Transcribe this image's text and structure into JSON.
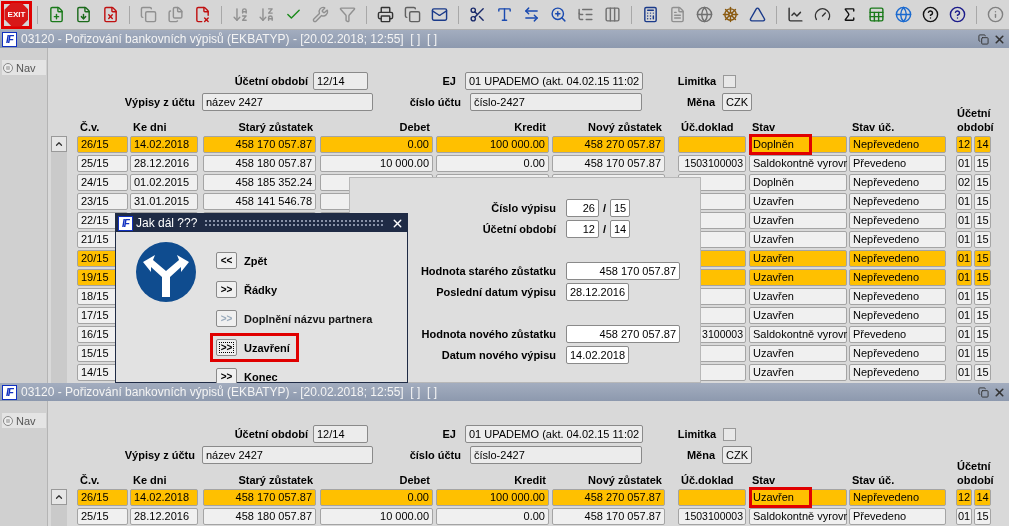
{
  "toolbar": {
    "exit_label": "EXIT",
    "exit_marked": true
  },
  "windows": [
    {
      "logo": "IF",
      "title": "03120 - Pořizování bankovních výpisů (EKBATYP) - [20.02.2018; 12:55]  [ ]  [ ]",
      "nav": "Nav",
      "form": {
        "period_label": "Účetní období",
        "period": "12/14",
        "ej_label": "EJ",
        "ej": "01 UPADEMO (akt. 04.02.15 11:02",
        "limit_label": "Limitka",
        "limit_checked": false,
        "account_label": "Výpisy z účtu",
        "account_name": "název 2427",
        "account_no_label": "číslo účtu",
        "account_no": "číslo-2427",
        "currency_label": "Měna",
        "currency": "CZK"
      },
      "columns": [
        "Č.v.",
        "Ke dni",
        "Starý zůstatek",
        "Debet",
        "Kredit",
        "Nový zůstatek",
        "Úč.doklad",
        "Stav",
        "Stav úč.",
        "Účetní období"
      ],
      "rows": [
        {
          "highlighted": true,
          "stav_marked": true,
          "cv": "26/15",
          "date": "14.02.2018",
          "old": "458 170 057.87",
          "debet": "0.00",
          "kredit": "100 000.00",
          "new": "458 270 057.87",
          "stav": "Doplněn",
          "stav_uc": "Nepřevedeno",
          "month": "12",
          "year": "14"
        },
        {
          "highlighted": false,
          "stav_marked": false,
          "cv": "25/15",
          "date": "28.12.2016",
          "old": "458 180 057.87",
          "debet": "10 000.00",
          "kredit": "0.00",
          "new": "458 170 057.87",
          "doklad": "1503100003",
          "stav": "Saldokontně vyrovr",
          "stav_uc": "Převedeno",
          "month": "01",
          "year": "15"
        },
        {
          "highlighted": false,
          "stav_marked": false,
          "cv": "24/15",
          "date": "01.02.2015",
          "old": "458 185 352.24",
          "stav": "Doplněn",
          "stav_uc": "Nepřevedeno",
          "month": "02",
          "year": "15"
        },
        {
          "highlighted": false,
          "stav_marked": false,
          "cv": "23/15",
          "date": "31.01.2015",
          "old": "458 141 546.78",
          "stav": "Uzavřen",
          "stav_uc": "Nepřevedeno",
          "month": "01",
          "year": "15"
        },
        {
          "highlighted": false,
          "stav_marked": false,
          "cv": "22/15",
          "stav": "Uzavřen",
          "stav_uc": "Nepřevedeno",
          "month": "01",
          "year": "15"
        },
        {
          "highlighted": false,
          "stav_marked": false,
          "cv": "21/15",
          "stav": "Uzavřen",
          "stav_uc": "Nepřevedeno",
          "month": "01",
          "year": "15"
        },
        {
          "highlighted": true,
          "stav_marked": false,
          "cv": "20/15",
          "stav": "Uzavřen",
          "stav_uc": "Nepřevedeno",
          "month": "01",
          "year": "15"
        },
        {
          "highlighted": true,
          "stav_marked": false,
          "cv": "19/15",
          "stav": "Uzavřen",
          "stav_uc": "Nepřevedeno",
          "month": "01",
          "year": "15"
        },
        {
          "highlighted": false,
          "stav_marked": false,
          "cv": "18/15",
          "stav": "Uzavřen",
          "stav_uc": "Nepřevedeno",
          "month": "01",
          "year": "15"
        },
        {
          "highlighted": false,
          "stav_marked": false,
          "cv": "17/15",
          "stav": "Uzavřen",
          "stav_uc": "Nepřevedeno",
          "month": "01",
          "year": "15"
        },
        {
          "highlighted": false,
          "stav_marked": false,
          "cv": "16/15",
          "doklad": "3100003",
          "stav": "Saldokontně vyrovr",
          "stav_uc": "Převedeno",
          "month": "01",
          "year": "15"
        },
        {
          "highlighted": false,
          "stav_marked": false,
          "cv": "15/15",
          "stav": "Uzavřen",
          "stav_uc": "Nepřevedeno",
          "month": "01",
          "year": "15"
        },
        {
          "highlighted": false,
          "stav_marked": false,
          "cv": "14/15",
          "stav": "Uzavřen",
          "stav_uc": "Nepřevedeno",
          "month": "01",
          "year": "15"
        }
      ],
      "statement_panel": {
        "groups": [
          [
            {
              "kind": "pair",
              "label": "Číslo výpisu",
              "value": "26",
              "separator": "/",
              "value2": "15"
            },
            {
              "kind": "pair",
              "label": "Účetní období",
              "value": "12",
              "separator": "/",
              "value2": "14"
            }
          ],
          [
            {
              "kind": "amount",
              "label": "Hodnota starého zůstatku",
              "value": "458 170 057.87"
            },
            {
              "kind": "date",
              "label": "Poslední datum výpisu",
              "value": "28.12.2016"
            }
          ],
          [
            {
              "kind": "amount",
              "label": "Hodnota nového zůstatku",
              "value": "458 270 057.87"
            },
            {
              "kind": "date",
              "label": "Datum nového výpisu",
              "value": "14.02.2018"
            }
          ]
        ]
      },
      "dialog": {
        "logo": "IF",
        "title": "Jak dál ???",
        "options": [
          {
            "arrows": "<<",
            "label": "Zpět",
            "disabled": false,
            "focused": false,
            "marked": false
          },
          {
            "arrows": ">>",
            "label": "Řádky",
            "disabled": false,
            "focused": false,
            "marked": false
          },
          {
            "arrows": ">>",
            "label": "Doplnění názvu partnera",
            "disabled": true,
            "focused": false,
            "marked": false
          },
          {
            "arrows": ">>",
            "label": "Uzavření",
            "disabled": false,
            "focused": true,
            "marked": true
          },
          {
            "arrows": ">>",
            "label": "Konec",
            "disabled": false,
            "focused": false,
            "marked": false
          }
        ]
      }
    },
    {
      "logo": "IF",
      "title": "03120 - Pořizování bankovních výpisů (EKBATYP) - [20.02.2018; 12:55]  [ ]  [ ]",
      "nav": "Nav",
      "form": {
        "period_label": "Účetní období",
        "period": "12/14",
        "ej_label": "EJ",
        "ej": "01 UPADEMO (akt. 04.02.15 11:02",
        "limit_label": "Limitka",
        "limit_checked": false,
        "account_label": "Výpisy z účtu",
        "account_name": "název 2427",
        "account_no_label": "číslo účtu",
        "account_no": "číslo-2427",
        "currency_label": "Měna",
        "currency": "CZK"
      },
      "columns": [
        "Č.v.",
        "Ke dni",
        "Starý zůstatek",
        "Debet",
        "Kredit",
        "Nový zůstatek",
        "Úč.doklad",
        "Stav",
        "Stav úč.",
        "Účetní období"
      ],
      "rows": [
        {
          "highlighted": true,
          "stav_marked": true,
          "cv": "26/15",
          "date": "14.02.2018",
          "old": "458 170 057.87",
          "debet": "0.00",
          "kredit": "100 000.00",
          "new": "458 270 057.87",
          "stav": "Uzavřen",
          "stav_uc": "Nepřevedeno",
          "month": "12",
          "year": "14"
        },
        {
          "highlighted": false,
          "stav_marked": false,
          "cv": "25/15",
          "date": "28.12.2016",
          "old": "458 180 057.87",
          "debet": "10 000.00",
          "kredit": "0.00",
          "new": "458 170 057.87",
          "doklad": "1503100003",
          "stav": "Saldokontně vyrovr",
          "stav_uc": "Převedeno",
          "month": "01",
          "year": "15"
        }
      ]
    }
  ]
}
